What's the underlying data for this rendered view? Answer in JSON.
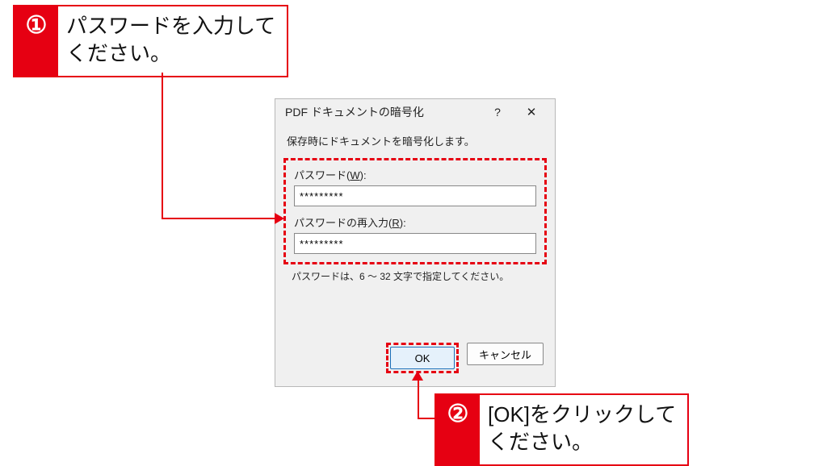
{
  "dialog": {
    "title": "PDF ドキュメントの暗号化",
    "help_tooltip": "?",
    "instruction": "保存時にドキュメントを暗号化します。",
    "password_label_prefix": "パスワード(",
    "password_accel": "W",
    "password_label_suffix": "):",
    "password_value": "*********",
    "reenter_label_prefix": "パスワードの再入力(",
    "reenter_accel": "R",
    "reenter_label_suffix": "):",
    "reenter_value": "*********",
    "hint": "パスワードは、6 ～ 32 文字で指定してください。",
    "ok_label": "OK",
    "cancel_label": "キャンセル"
  },
  "callouts": {
    "c1_num": "①",
    "c1_text": "パスワードを入力して\nください。",
    "c2_num": "②",
    "c2_text": "[OK]をクリックして\nください。"
  }
}
